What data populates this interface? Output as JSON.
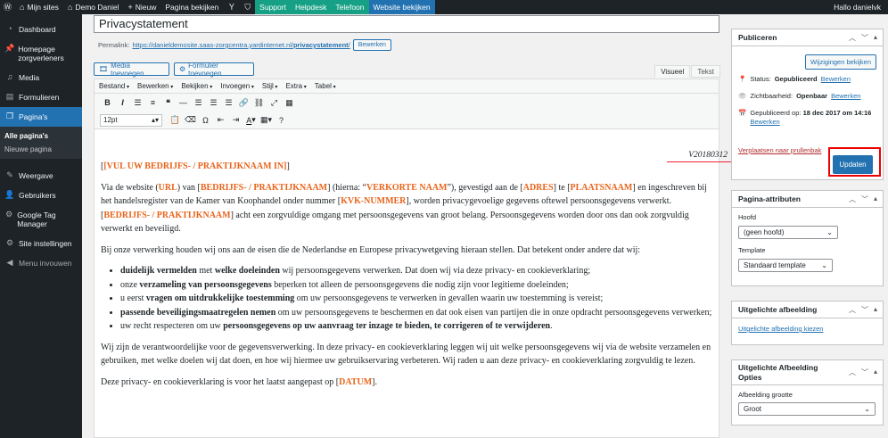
{
  "adminbar": {
    "sites": "Mijn sites",
    "site": "Demo Daniel",
    "new": "Nieuw",
    "view": "Pagina bekijken",
    "support": "Support",
    "helpdesk": "Helpdesk",
    "telefoon": "Telefoon",
    "website": "Website bekijken",
    "greeting": "Hallo danielvk"
  },
  "sidebar": {
    "items": [
      {
        "label": "Dashboard",
        "icon": "dashboard-icon"
      },
      {
        "label": "Homepage zorgverleners",
        "icon": "pin-icon"
      },
      {
        "label": "Media",
        "icon": "media-icon"
      },
      {
        "label": "Formulieren",
        "icon": "forms-icon"
      },
      {
        "label": "Pagina's",
        "icon": "pages-icon"
      },
      {
        "label": "Weergave",
        "icon": "appearance-icon"
      },
      {
        "label": "Gebruikers",
        "icon": "users-icon"
      },
      {
        "label": "Google Tag Manager",
        "icon": "settings-icon"
      },
      {
        "label": "Site instellingen",
        "icon": "settings-icon"
      },
      {
        "label": "Menu invouwen",
        "icon": "collapse-icon"
      }
    ],
    "sub": [
      "Alle pagina's",
      "Nieuwe pagina"
    ]
  },
  "editor": {
    "title": "Privacystatement",
    "permalink_label": "Permalink:",
    "permalink_base": "https://danieldemosite.saas-zorgcentra.yardinternet.nl/",
    "permalink_slug": "privacystatement",
    "permalink_end": "/",
    "edit": "Bewerken",
    "media_btn": "Media toevoegen",
    "form_btn": "Formulier toevoegen",
    "tab_visual": "Visueel",
    "tab_text": "Tekst",
    "menus": [
      "Bestand",
      "Bewerken",
      "Bekijken",
      "Invoegen",
      "Stijl",
      "Extra",
      "Tabel"
    ],
    "font_size": "12pt",
    "version": "V20180312"
  },
  "content": {
    "p1a": "[VUL UW BEDRIJFS- / PRAKTIJKNAAM IN]",
    "p2_1": "Via de website (",
    "p2_url": "URL",
    "p2_2": ") van [",
    "p2_name": "BEDRIJFS- / PRAKTIJKNAAM",
    "p2_3": "] (hierna: “",
    "p2_short": "VERKORTE NAAM",
    "p2_4": "”), gevestigd aan de [",
    "p2_adres": "ADRES",
    "p2_5": "] te [",
    "p2_plaats": "PLAATSNAAM",
    "p2_6": "] en ingeschreven bij het handelsregister van de Kamer van Koophandel onder nummer [",
    "p2_kvk": "KVK-NUMMER",
    "p2_7": "], worden privacygevoelige gegevens oftewel persoonsgegevens verwerkt. [",
    "p2_name2": "BEDRIJFS- / PRAKTIJKNAAM",
    "p2_8": "] acht een zorgvuldige omgang met persoonsgegevens van groot belang. Persoonsgegevens worden door ons dan ook zorgvuldig verwerkt en beveiligd.",
    "p3": "Bij onze verwerking houden wij ons aan de eisen die de Nederlandse en Europese privacywetgeving hieraan stellen. Dat betekent onder andere dat wij:",
    "li1b": "duidelijk vermelden",
    "li1m": " met ",
    "li1b2": "welke doeleinden",
    "li1e": " wij persoonsgegevens verwerken. Dat doen wij via deze privacy- en cookieverklaring;",
    "li2a": "onze ",
    "li2b": "verzameling van persoonsgegevens",
    "li2e": " beperken tot alleen de persoonsgegevens die nodig zijn voor legitieme doeleinden;",
    "li3a": "u eerst ",
    "li3b": "vragen om uitdrukkelijke toestemming",
    "li3e": " om uw persoonsgegevens te verwerken in gevallen waarin uw toestemming is vereist;",
    "li4b": "passende beveiligingsmaatregelen nemen",
    "li4e": " om uw persoonsgegevens te beschermen en dat ook eisen van partijen die in onze opdracht persoonsgegevens verwerken;",
    "li5a": "uw recht respecteren om uw ",
    "li5b": "persoonsgegevens op uw aanvraag ter inzage te bieden, te corrigeren of te verwijderen",
    "li5e": ".",
    "p4": "Wij zijn de verantwoordelijke voor de gegevensverwerking. In deze privacy- en cookieverklaring leggen wij uit welke persoonsgegevens wij via de website verzamelen en gebruiken, met welke doelen wij dat doen, en hoe wij hiermee uw gebruikservaring verbeteren. Wij raden u aan deze privacy- en cookieverklaring zorgvuldig te lezen.",
    "p5a": "Deze privacy- en cookieverklaring is voor het laatst aangepast op [",
    "p5b": "DATUM",
    "p5c": "]."
  },
  "publish": {
    "title": "Publiceren",
    "preview": "Wijzigingen bekijken",
    "status_label": "Status:",
    "status": "Gepubliceerd",
    "visibility_label": "Zichtbaarheid:",
    "visibility": "Openbaar",
    "date_label": "Gepubliceerd op:",
    "date": "18 dec 2017 om 14:16",
    "edit": "Bewerken",
    "trash": "Verplaatsen naar prullenbak",
    "update": "Updaten"
  },
  "attributes": {
    "title": "Pagina-attributen",
    "parent_label": "Hoofd",
    "parent": "(geen hoofd)",
    "template_label": "Template",
    "template": "Standaard template"
  },
  "featured": {
    "title": "Uitgelichte afbeelding",
    "link": "Uitgelichte afbeelding kiezen"
  },
  "featured2": {
    "title": "Uitgelichte Afbeelding Opties",
    "size_label": "Afbeelding grootte",
    "size": "Groot"
  }
}
